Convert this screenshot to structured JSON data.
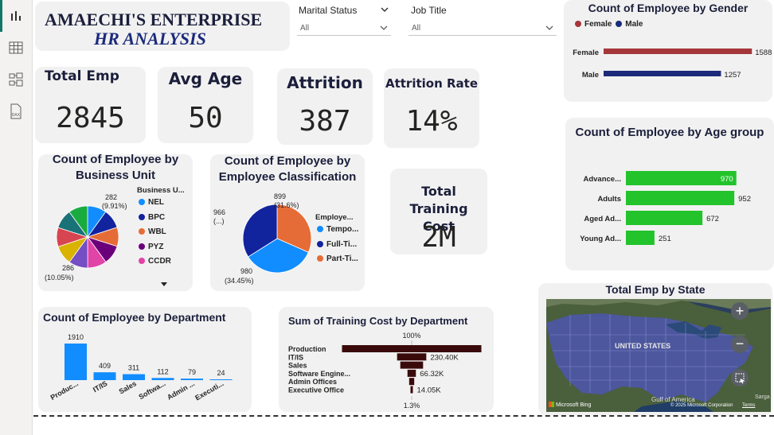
{
  "header": {
    "title_line1": "AMAECHI'S ENTERPRISE",
    "title_line2": "HR ANALYSIS"
  },
  "slicers": [
    {
      "label": "Marital Status",
      "value": "All"
    },
    {
      "label": "Job Title",
      "value": "All"
    }
  ],
  "kpis": {
    "total_emp": {
      "label": "Total Emp",
      "value": "2845"
    },
    "avg_age": {
      "label": "Avg Age",
      "value": "50"
    },
    "attrition": {
      "label": "Attrition",
      "value": "387"
    },
    "attrition_rate": {
      "label": "Attrition Rate",
      "value": "14%"
    },
    "training_cost": {
      "label": "Total Training Cost",
      "value": "2M"
    }
  },
  "gender": {
    "title": "Count of Employee by Gender",
    "legend": [
      "Female",
      "Male"
    ],
    "colors": [
      "#a4373a",
      "#1b2a7a"
    ]
  },
  "age": {
    "title": "Count of Employee by Age group",
    "color": "#22c32b"
  },
  "business": {
    "title": "Count of Employee by Business Unit",
    "legend_title": "Business U...",
    "label_top": "282",
    "label_top_pct": "(9.91%)",
    "label_bottom": "286",
    "label_bottom_pct": "(10.05%)"
  },
  "classification": {
    "title": "Count of Employee by Employee Classification",
    "legend_title": "Employe...",
    "label_a": "899",
    "label_a_pct": "(31.6%)",
    "label_b": "966",
    "label_b_pct": "(...)",
    "label_c": "980",
    "label_c_pct": "(34.45%)"
  },
  "department": {
    "title": "Count of Employee by Department",
    "color": "#118dff"
  },
  "training": {
    "title": "Sum of Training Cost by Department",
    "top_label": "100%",
    "bottom_label": "1.3%",
    "color": "#3a0a0a"
  },
  "map": {
    "title": "Total Emp by State",
    "country_label": "UNITED STATES",
    "gulf_label": "Gulf of America",
    "sargasso_label": "Sarga",
    "bing_label": "Microsoft Bing",
    "copyright": "© 2025 Microsoft Corporation",
    "terms": "Terms"
  },
  "chart_data": [
    {
      "type": "bar",
      "title": "Count of Employee by Gender",
      "categories": [
        "Female",
        "Male"
      ],
      "values": [
        1588,
        1257
      ],
      "orientation": "horizontal"
    },
    {
      "type": "bar",
      "title": "Count of Employee by Age group",
      "categories": [
        "Advance...",
        "Adults",
        "Aged Ad...",
        "Young Ad..."
      ],
      "values": [
        970,
        952,
        672,
        251
      ],
      "orientation": "horizontal"
    },
    {
      "type": "pie",
      "title": "Count of Employee by Business Unit",
      "legend": [
        "NEL",
        "BPC",
        "WBL",
        "PYZ",
        "CCDR"
      ],
      "legend_colors": [
        "#118dff",
        "#12239e",
        "#e66c37",
        "#6b007b",
        "#e044a7"
      ],
      "slice_colors": [
        "#118dff",
        "#12239e",
        "#e66c37",
        "#6b007b",
        "#e044a7",
        "#744ec2",
        "#d9b300",
        "#d64550",
        "#197278",
        "#1aab40"
      ],
      "labeled_values": [
        282,
        286
      ]
    },
    {
      "type": "pie",
      "title": "Count of Employee by Employee Classification",
      "categories": [
        "Tempo...",
        "Full-Ti...",
        "Part-Ti..."
      ],
      "values": [
        980,
        966,
        899
      ],
      "colors": [
        "#118dff",
        "#12239e",
        "#e66c37"
      ]
    },
    {
      "type": "bar",
      "title": "Count of Employee by Department",
      "categories": [
        "Produc...",
        "IT/IS",
        "Sales",
        "Softwa...",
        "Admin ...",
        "Executi..."
      ],
      "values": [
        1910,
        409,
        311,
        112,
        79,
        24
      ]
    },
    {
      "type": "bar",
      "subtype": "funnel",
      "title": "Sum of Training Cost by Department",
      "categories": [
        "Production",
        "IT/IS",
        "Sales",
        "Software Engine...",
        "Admin Offices",
        "Executive Office"
      ],
      "values": [
        1100000,
        230400,
        180000,
        66320,
        40000,
        14050
      ],
      "value_labels": [
        "",
        "230.40K",
        "",
        "66.32K",
        "",
        "14.05K"
      ]
    }
  ]
}
